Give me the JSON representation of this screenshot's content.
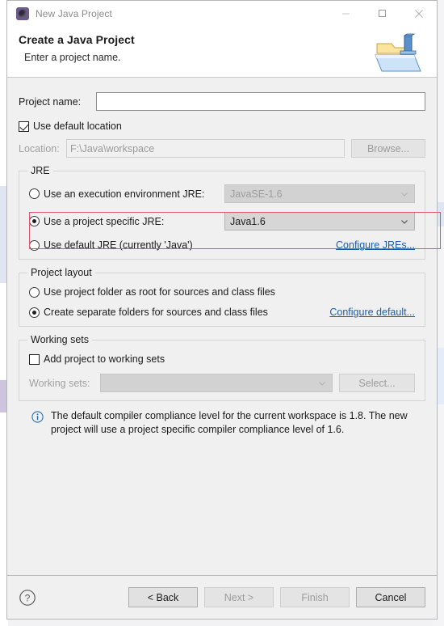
{
  "window": {
    "title": "New Java Project",
    "app_icon": "java-project-icon",
    "controls": {
      "minimize": "minimize-icon",
      "maximize": "maximize-icon",
      "close": "close-icon"
    }
  },
  "header": {
    "title": "Create a Java Project",
    "subtitle": "Enter a project name.",
    "image": "new-java-project-folder-icon"
  },
  "project_name": {
    "label": "Project name:",
    "value": "",
    "placeholder": ""
  },
  "location": {
    "use_default_label": "Use default location",
    "use_default_checked": true,
    "label": "Location:",
    "value": "F:\\Java\\workspace",
    "browse_label": "Browse...",
    "browse_enabled": false
  },
  "jre": {
    "group_label": "JRE",
    "options": [
      {
        "label": "Use an execution environment JRE:",
        "selected": false,
        "combo_value": "JavaSE-1.6",
        "combo_enabled": false
      },
      {
        "label": "Use a project specific JRE:",
        "selected": true,
        "combo_value": "Java1.6",
        "combo_enabled": true
      },
      {
        "label": "Use default JRE (currently 'Java')",
        "selected": false
      }
    ],
    "configure_link": "Configure JREs...",
    "highlight_color": "#e2526a"
  },
  "project_layout": {
    "group_label": "Project layout",
    "options": [
      {
        "label": "Use project folder as root for sources and class files",
        "selected": false
      },
      {
        "label": "Create separate folders for sources and class files",
        "selected": true
      }
    ],
    "configure_link": "Configure default..."
  },
  "working_sets": {
    "group_label": "Working sets",
    "add_label": "Add project to working sets",
    "add_checked": false,
    "label": "Working sets:",
    "value": "",
    "combo_enabled": false,
    "select_label": "Select...",
    "select_enabled": false
  },
  "message": {
    "icon": "info-icon",
    "text": "The default compiler compliance level for the current workspace is 1.8. The new project will use a project specific compiler compliance level of 1.6."
  },
  "buttons": {
    "help": "help-icon",
    "back": "< Back",
    "back_enabled": true,
    "next": "Next >",
    "next_enabled": false,
    "finish": "Finish",
    "finish_enabled": false,
    "cancel": "Cancel",
    "cancel_enabled": true
  }
}
